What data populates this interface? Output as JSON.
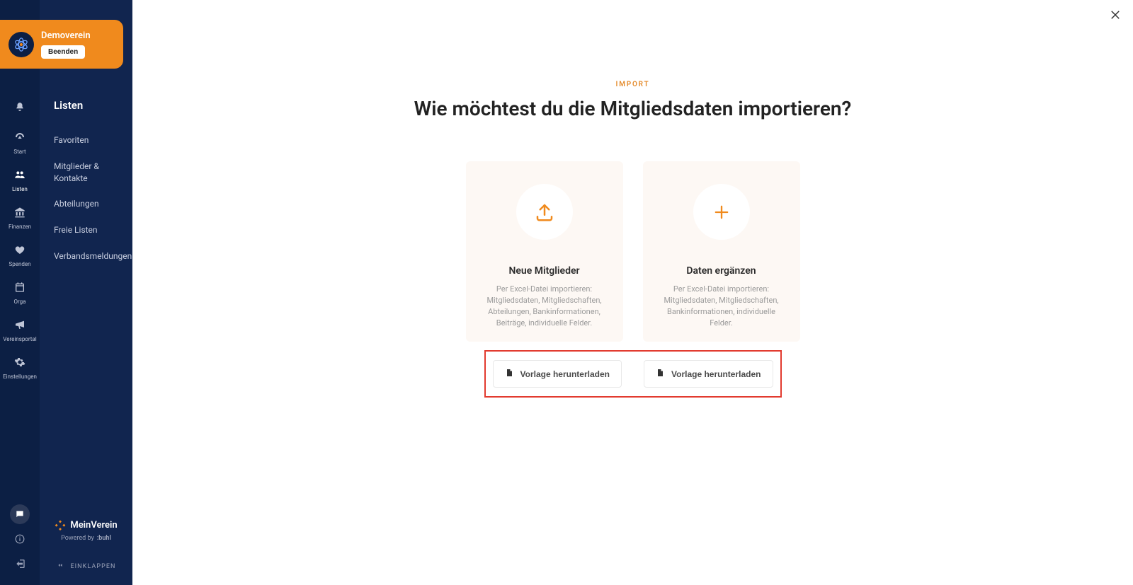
{
  "org": {
    "name": "Demoverein",
    "exit_label": "Beenden"
  },
  "rail": {
    "items": [
      {
        "icon": "bell-icon",
        "label": ""
      },
      {
        "icon": "gauge-icon",
        "label": "Start"
      },
      {
        "icon": "users-icon",
        "label": "Listen"
      },
      {
        "icon": "bank-icon",
        "label": "Finanzen"
      },
      {
        "icon": "heart-hands-icon",
        "label": "Spenden"
      },
      {
        "icon": "calendar-icon",
        "label": "Orga"
      },
      {
        "icon": "megaphone-icon",
        "label": "Vereinsportal"
      },
      {
        "icon": "gear-icon",
        "label": "Einstellungen"
      }
    ]
  },
  "sidebar": {
    "title": "Listen",
    "links": [
      {
        "label": "Favoriten"
      },
      {
        "label": "Mitglieder & Kontakte"
      },
      {
        "label": "Abteilungen"
      },
      {
        "label": "Freie Listen"
      },
      {
        "label": "Verbandsmeldungen"
      }
    ],
    "brand_name": "MeinVerein",
    "powered_prefix": "Powered by",
    "powered_name": ":buhl",
    "collapse_label": "EINKLAPPEN"
  },
  "main": {
    "overline": "IMPORT",
    "headline": "Wie möchtest du die Mitgliedsdaten importieren?",
    "options": [
      {
        "title": "Neue Mitglieder",
        "desc": "Per Excel-Datei importieren: Mitgliedsdaten, Mitgliedschaften, Abteilungen, Bankinformationen, Beiträge, individuelle Felder."
      },
      {
        "title": "Daten ergänzen",
        "desc": "Per Excel-Datei importieren: Mitgliedsdaten, Mitgliedschaften, Bankinformationen, individuelle Felder."
      }
    ],
    "download_label": "Vorlage herunterladen"
  },
  "colors": {
    "accent": "#f08a1d",
    "rail_bg": "#0c1f44",
    "sidebar_bg": "#11254f",
    "card_bg": "#fdf8f4",
    "highlight_border": "#e23b2f"
  }
}
